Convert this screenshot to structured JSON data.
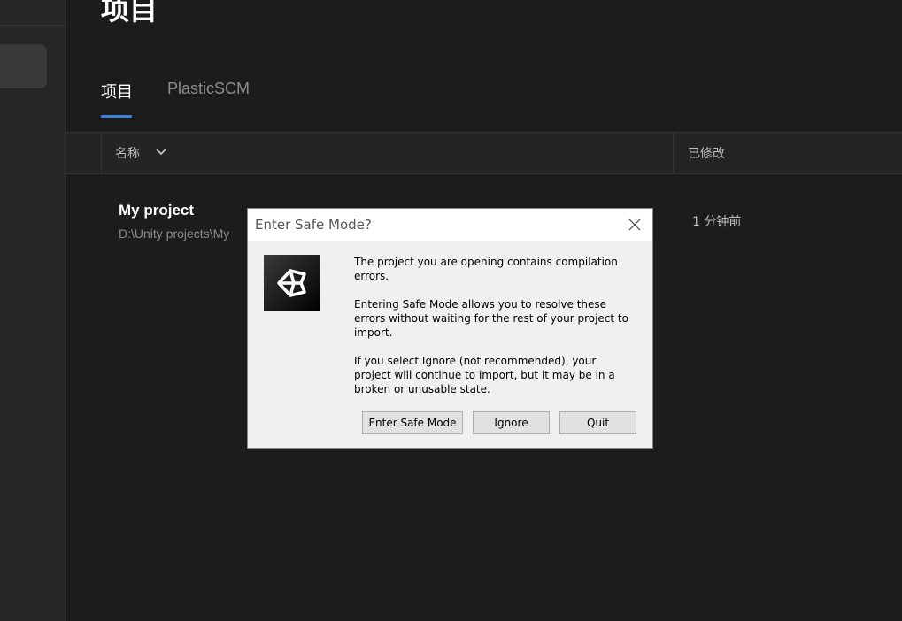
{
  "page": {
    "title": "项目"
  },
  "tabs": [
    {
      "label": "项目",
      "active": true
    },
    {
      "label": "PlasticSCM",
      "active": false
    }
  ],
  "table": {
    "columns": {
      "name": "名称",
      "modified": "已修改"
    },
    "rows": [
      {
        "name": "My project",
        "path": "D:\\Unity projects\\My",
        "modified": "1 分钟前"
      }
    ]
  },
  "dialog": {
    "title": "Enter Safe Mode?",
    "paragraphs": [
      "The project you are opening contains compilation errors.",
      "Entering Safe Mode allows you to resolve these errors without waiting for the rest of your project to import.",
      "If you select Ignore (not recommended), your project will continue to import, but it may be in a broken or unusable state."
    ],
    "buttons": {
      "safe_mode": "Enter Safe Mode",
      "ignore": "Ignore",
      "quit": "Quit"
    },
    "icon": "unity-logo-icon"
  },
  "colors": {
    "accent": "#3b82d6",
    "background": "#1c1c1c",
    "dialog_bg": "#f0f0f0"
  }
}
